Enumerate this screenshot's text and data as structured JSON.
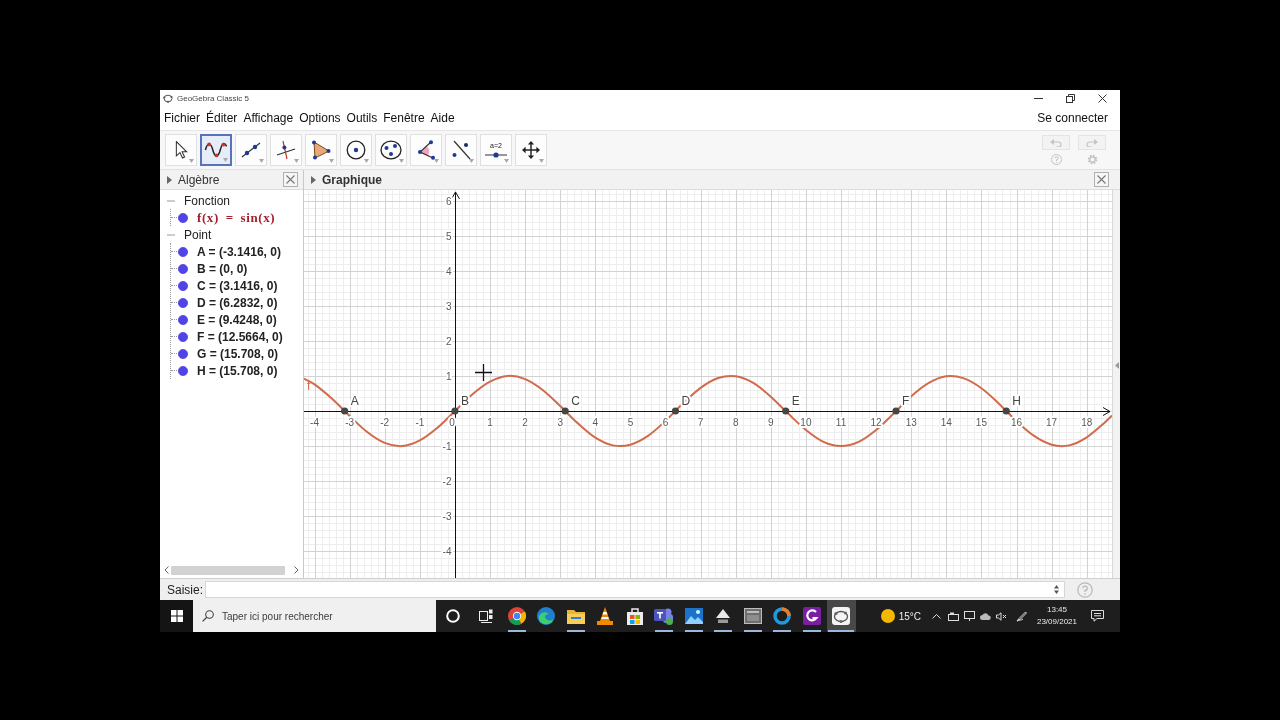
{
  "window": {
    "title": "GeoGebra Classic 5"
  },
  "menu": {
    "items": [
      "Fichier",
      "Éditer",
      "Affichage",
      "Options",
      "Outils",
      "Fenêtre",
      "Aide"
    ],
    "account": "Se connecter"
  },
  "toolbar": {
    "tools": [
      {
        "kind": "move",
        "selected": false
      },
      {
        "kind": "function",
        "selected": true
      },
      {
        "kind": "line",
        "selected": false
      },
      {
        "kind": "perpendicular",
        "selected": false
      },
      {
        "kind": "polygon",
        "selected": false
      },
      {
        "kind": "circle",
        "selected": false
      },
      {
        "kind": "conic",
        "selected": false
      },
      {
        "kind": "angle",
        "selected": false
      },
      {
        "kind": "reflect",
        "selected": false
      },
      {
        "kind": "slider",
        "selected": false,
        "label": "a=2"
      },
      {
        "kind": "move-view",
        "selected": false
      }
    ],
    "history": [
      {
        "kind": "undo",
        "disabled": true
      },
      {
        "kind": "redo",
        "disabled": true
      }
    ]
  },
  "algebra": {
    "title": "Algèbre",
    "groups": [
      {
        "label": "Fonction",
        "expanded": true,
        "children": [
          {
            "kind": "function",
            "text": "f(x) = sin(x)",
            "visible": true,
            "color": "#a3202e"
          }
        ]
      },
      {
        "label": "Point",
        "expanded": true,
        "children": [
          {
            "kind": "point",
            "text": "A = (-3.1416, 0)",
            "visible": true,
            "color": "#222222"
          },
          {
            "kind": "point",
            "text": "B = (0, 0)",
            "visible": true,
            "color": "#222222"
          },
          {
            "kind": "point",
            "text": "C = (3.1416, 0)",
            "visible": true,
            "color": "#222222"
          },
          {
            "kind": "point",
            "text": "D = (6.2832, 0)",
            "visible": true,
            "color": "#222222"
          },
          {
            "kind": "point",
            "text": "E = (9.4248, 0)",
            "visible": true,
            "color": "#222222"
          },
          {
            "kind": "point",
            "text": "F = (12.5664, 0)",
            "visible": true,
            "color": "#222222"
          },
          {
            "kind": "point",
            "text": "G = (15.708, 0)",
            "visible": true,
            "color": "#222222"
          },
          {
            "kind": "point",
            "text": "H = (15.708, 0)",
            "visible": true,
            "color": "#222222"
          }
        ]
      }
    ]
  },
  "graphics": {
    "title": "Graphique",
    "chart_data": {
      "type": "line",
      "grid": true,
      "x": [
        -4.3,
        -4,
        -3.5,
        -3,
        -2.5,
        -2,
        -1.5,
        -1,
        -0.5,
        0,
        0.5,
        1,
        1.5,
        2,
        2.5,
        3,
        3.5,
        4,
        4.5,
        5,
        5.5,
        6,
        6.5,
        7,
        7.5,
        8,
        8.5,
        9,
        9.5,
        10,
        10.5,
        11,
        11.5,
        12,
        12.5,
        13,
        13.5,
        14,
        14.5,
        15,
        15.5,
        16,
        16.5,
        17,
        17.5,
        18,
        18.5,
        18.72
      ],
      "series": [
        {
          "name": "f",
          "color": "#d26b4b",
          "values": [
            0.92,
            0.76,
            0.35,
            -0.14,
            -0.6,
            -0.91,
            -1,
            -0.84,
            -0.48,
            0,
            0.48,
            0.84,
            1,
            0.91,
            0.6,
            0.14,
            -0.35,
            -0.76,
            -0.98,
            -0.96,
            -0.71,
            -0.28,
            0.22,
            0.66,
            0.94,
            0.99,
            0.8,
            0.41,
            -0.08,
            -0.54,
            -0.88,
            -1,
            -0.88,
            -0.54,
            -0.07,
            0.42,
            0.8,
            0.99,
            0.93,
            0.65,
            0.21,
            -0.29,
            -0.71,
            -0.96,
            -0.98,
            -0.75,
            -0.34,
            -0.13
          ]
        }
      ],
      "xlim": [
        -4.3,
        18.72
      ],
      "ylim": [
        -4.76,
        6.3
      ],
      "xticks": [
        -4,
        -3,
        -2,
        -1,
        0,
        1,
        2,
        3,
        4,
        5,
        6,
        7,
        8,
        9,
        10,
        11,
        12,
        13,
        14,
        15,
        16,
        17,
        18
      ],
      "yticks": [
        -4,
        -3,
        -2,
        -1,
        1,
        2,
        3,
        4,
        5,
        6
      ],
      "annotations": [
        {
          "text": "A",
          "x": -3.1416,
          "y": 0
        },
        {
          "text": "B",
          "x": 0,
          "y": 0
        },
        {
          "text": "C",
          "x": 3.1416,
          "y": 0
        },
        {
          "text": "D",
          "x": 6.2832,
          "y": 0
        },
        {
          "text": "E",
          "x": 9.4248,
          "y": 0
        },
        {
          "text": "F",
          "x": 12.5664,
          "y": 0
        },
        {
          "text": "H",
          "x": 15.708,
          "y": 0
        }
      ]
    }
  },
  "input_bar": {
    "label": "Saisie:"
  },
  "taskbar": {
    "search": {
      "placeholder": "Taper ici pour rechercher"
    },
    "apps": [
      {
        "kind": "circle",
        "running": false,
        "selected": false
      },
      {
        "kind": "task-view",
        "running": false,
        "selected": false
      },
      {
        "kind": "multicolor-circle",
        "running": true,
        "selected": false
      },
      {
        "kind": "swirl",
        "running": false,
        "selected": false
      },
      {
        "kind": "folder",
        "running": true,
        "selected": false
      },
      {
        "kind": "cone",
        "running": false,
        "selected": false
      },
      {
        "kind": "bag",
        "running": false,
        "selected": false
      },
      {
        "kind": "people-tile",
        "running": true,
        "selected": false
      },
      {
        "kind": "landscape",
        "running": true,
        "selected": false
      },
      {
        "kind": "triangle",
        "running": true,
        "selected": false
      },
      {
        "kind": "window-frame",
        "running": true,
        "selected": false
      },
      {
        "kind": "ring",
        "running": true,
        "selected": false
      },
      {
        "kind": "arc-tile",
        "running": true,
        "selected": false
      },
      {
        "kind": "ellipse-dots",
        "running": true,
        "selected": true
      }
    ],
    "weather": "15°C",
    "time": "13:45",
    "date": "23/09/2021"
  }
}
